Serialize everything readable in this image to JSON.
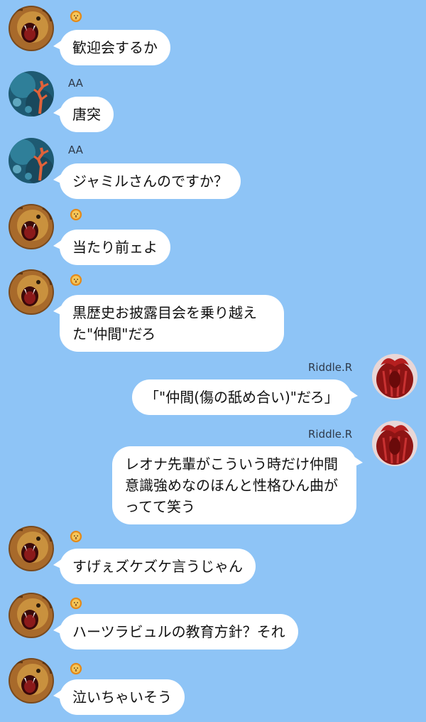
{
  "colors": {
    "background": "#8EC4F6",
    "bubble": "#FFFFFF",
    "name_text": "#2F3A4A"
  },
  "messages": [
    {
      "sender_label": "",
      "sender_icon": "lion-emoji-icon",
      "avatar": "lion-avatar",
      "text": "歓迎会するか",
      "side": "left"
    },
    {
      "sender_label": "AA",
      "sender_icon": "",
      "avatar": "ocean-coral-avatar",
      "text": "唐突",
      "side": "left"
    },
    {
      "sender_label": "AA",
      "sender_icon": "",
      "avatar": "ocean-coral-avatar",
      "text": "ジャミルさんのですか？",
      "side": "left"
    },
    {
      "sender_label": "",
      "sender_icon": "lion-emoji-icon",
      "avatar": "lion-avatar",
      "text": "当たり前ェよ",
      "side": "left"
    },
    {
      "sender_label": "",
      "sender_icon": "lion-emoji-icon",
      "avatar": "lion-avatar",
      "text": "黒歴史お披露目会を乗り越え\nた\"仲間\"だろ",
      "side": "left"
    },
    {
      "sender_label": "Riddle.R",
      "sender_icon": "",
      "avatar": "red-hair-avatar",
      "text": "「\"仲間(傷の舐め合い)\"だろ」",
      "side": "right"
    },
    {
      "sender_label": "Riddle.R",
      "sender_icon": "",
      "avatar": "red-hair-avatar",
      "text": "レオナ先輩がこういう時だけ仲間\n意識強めなのほんと性格ひん曲が\nってて笑う",
      "side": "right"
    },
    {
      "sender_label": "",
      "sender_icon": "lion-emoji-icon",
      "avatar": "lion-avatar",
      "text": "すげぇズケズケ言うじゃん",
      "side": "left"
    },
    {
      "sender_label": "",
      "sender_icon": "lion-emoji-icon",
      "avatar": "lion-avatar",
      "text": "ハーツラビュルの教育方針？それ",
      "side": "left"
    },
    {
      "sender_label": "",
      "sender_icon": "lion-emoji-icon",
      "avatar": "lion-avatar",
      "text": "泣いちゃいそう",
      "side": "left"
    }
  ]
}
